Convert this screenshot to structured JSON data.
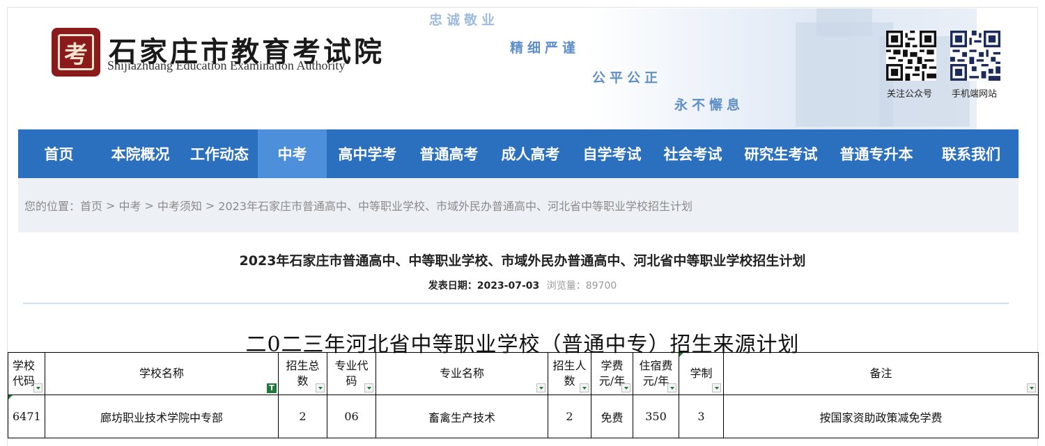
{
  "header": {
    "site_title": "石家庄市教育考试院",
    "site_subtitle": "Shijiazhuang Education Examination Authority",
    "logo_char": "考",
    "slogans": [
      "忠诚敬业",
      "精细严谨",
      "公平公正",
      "永不懈息"
    ],
    "qr_labels": [
      "关注公众号",
      "手机端网站"
    ]
  },
  "nav": {
    "items": [
      "首页",
      "本院概况",
      "工作动态",
      "中考",
      "高中学考",
      "普通高考",
      "成人高考",
      "自学考试",
      "社会考试",
      "研究生考试",
      "普通专升本",
      "联系我们"
    ],
    "active_index": 3
  },
  "breadcrumb": {
    "prefix": "您的位置：",
    "items": [
      "首页",
      "中考",
      "中考须知",
      "2023年石家庄市普通高中、中等职业学校、市域外民办普通高中、河北省中等职业学校招生计划"
    ],
    "separator": ">"
  },
  "article": {
    "title": "2023年石家庄市普通高中、中等职业学校、市域外民办普通高中、河北省中等职业学校招生计划",
    "date_label": "发表日期：",
    "date": "2023-07-03",
    "views_label": "浏览量：",
    "views": "89700"
  },
  "plan": {
    "title": "二0二三年河北省中等职业学校（普通中专）招生来源计划",
    "headers": [
      "学校\n代码",
      "学校名称",
      "招生总\n数",
      "专业代\n码",
      "专业名称",
      "招生人\n数",
      "学费\n元/年",
      "住宿费\n元/年",
      "学制",
      "备注"
    ],
    "rows": [
      [
        "6471",
        "廊坊职业技术学院中专部",
        "2",
        "06",
        "畜禽生产技术",
        "2",
        "免费",
        "350",
        "3",
        "按国家资助政策减免学费"
      ]
    ]
  },
  "colors": {
    "nav_bg": "#2b6fbf",
    "nav_active": "#4d8fdb",
    "breadcrumb_bg": "#edf1f6",
    "logo": "#8b1a1a",
    "slogan": "#5f8fc8"
  }
}
